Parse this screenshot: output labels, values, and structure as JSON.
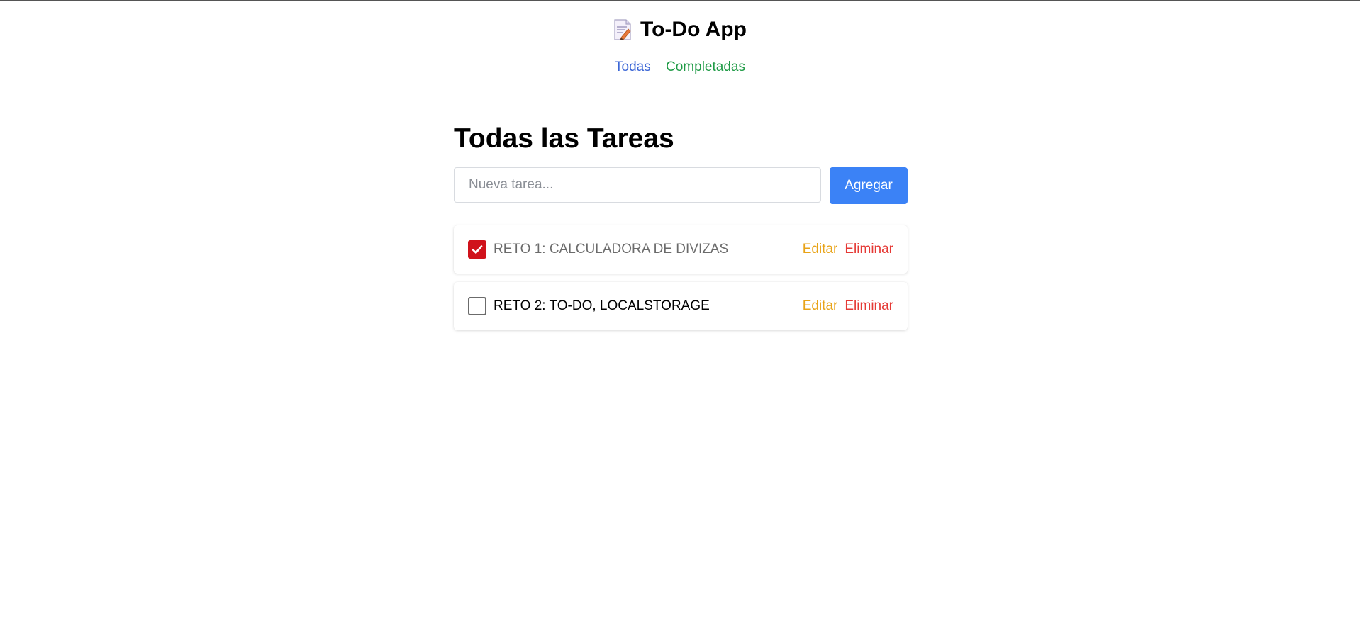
{
  "app": {
    "title": "To-Do App",
    "icon": "memo-icon"
  },
  "nav": {
    "all_label": "Todas",
    "completed_label": "Completadas"
  },
  "main": {
    "title": "Todas las Tareas",
    "input": {
      "value": "",
      "placeholder": "Nueva tarea..."
    },
    "add_label": "Agregar"
  },
  "tasks": [
    {
      "text": "RETO 1: CALCULADORA DE DIVIZAS",
      "completed": true,
      "edit_label": "Editar",
      "delete_label": "Eliminar"
    },
    {
      "text": "RETO 2: TO-DO, LOCALSTORAGE",
      "completed": false,
      "edit_label": "Editar",
      "delete_label": "Eliminar"
    }
  ],
  "colors": {
    "accent": "#3b82f6",
    "nav_all": "#3b66d6",
    "nav_completed": "#1e9a45",
    "edit": "#e8a317",
    "delete": "#e53935",
    "checked": "#d0121b"
  }
}
